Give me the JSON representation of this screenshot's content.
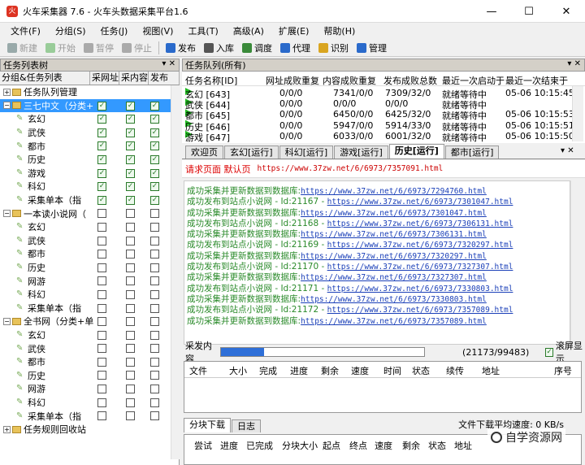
{
  "window": {
    "title": "火车采集器 7.6 - 火车头数据采集平台1.6",
    "icon_text": "火",
    "min": "—",
    "max": "☐",
    "close": "✕"
  },
  "menu": [
    "文件(F)",
    "分组(S)",
    "任务(J)",
    "视图(V)",
    "工具(T)",
    "高级(A)",
    "扩展(E)",
    "帮助(H)"
  ],
  "toolbar": [
    {
      "label": "新建",
      "enabled": false,
      "icon": "new-icon",
      "color": "#9aa"
    },
    {
      "label": "开始",
      "enabled": false,
      "icon": "play-icon",
      "color": "#9c9"
    },
    {
      "label": "暂停",
      "enabled": false,
      "icon": "pause-icon",
      "color": "#aaa"
    },
    {
      "label": "停止",
      "enabled": false,
      "icon": "stop-icon",
      "color": "#aaa"
    },
    {
      "label": "发布",
      "enabled": true,
      "icon": "publish-icon",
      "color": "#2a6acb"
    },
    {
      "label": "入库",
      "enabled": true,
      "icon": "import-icon",
      "color": "#555"
    },
    {
      "label": "调度",
      "enabled": true,
      "icon": "schedule-icon",
      "color": "#3a8a3a"
    },
    {
      "label": "代理",
      "enabled": true,
      "icon": "proxy-icon",
      "color": "#2a6acb"
    },
    {
      "label": "识别",
      "enabled": true,
      "icon": "recognize-icon",
      "color": "#d9a520"
    },
    {
      "label": "管理",
      "enabled": true,
      "icon": "manage-icon",
      "color": "#2a6acb"
    }
  ],
  "left": {
    "title": "任务列表树",
    "columns": [
      "分组&任务列表",
      "采网址",
      "采内容",
      "发布"
    ],
    "tree": [
      {
        "name": "任务队列管理",
        "level": 0,
        "kind": "root",
        "checks": null
      },
      {
        "name": "三七中文（分类+",
        "level": 0,
        "kind": "folder",
        "checks": [
          true,
          true,
          true
        ],
        "selected": true
      },
      {
        "name": "玄幻",
        "level": 1,
        "kind": "task",
        "checks": [
          true,
          true,
          true
        ]
      },
      {
        "name": "武侠",
        "level": 1,
        "kind": "task",
        "checks": [
          true,
          true,
          true
        ]
      },
      {
        "name": "都市",
        "level": 1,
        "kind": "task",
        "checks": [
          true,
          true,
          true
        ]
      },
      {
        "name": "历史",
        "level": 1,
        "kind": "task",
        "checks": [
          true,
          true,
          true
        ]
      },
      {
        "name": "游戏",
        "level": 1,
        "kind": "task",
        "checks": [
          true,
          true,
          true
        ]
      },
      {
        "name": "科幻",
        "level": 1,
        "kind": "task",
        "checks": [
          true,
          true,
          true
        ]
      },
      {
        "name": "采集单本（指",
        "level": 1,
        "kind": "task",
        "checks": [
          true,
          true,
          true
        ]
      },
      {
        "name": "一本读小说网（",
        "level": 0,
        "kind": "folder",
        "checks": [
          false,
          false,
          false
        ]
      },
      {
        "name": "玄幻",
        "level": 1,
        "kind": "task",
        "checks": [
          false,
          false,
          false
        ]
      },
      {
        "name": "武侠",
        "level": 1,
        "kind": "task",
        "checks": [
          false,
          false,
          false
        ]
      },
      {
        "name": "都市",
        "level": 1,
        "kind": "task",
        "checks": [
          false,
          false,
          false
        ]
      },
      {
        "name": "历史",
        "level": 1,
        "kind": "task",
        "checks": [
          false,
          false,
          false
        ]
      },
      {
        "name": "网游",
        "level": 1,
        "kind": "task",
        "checks": [
          false,
          false,
          false
        ]
      },
      {
        "name": "科幻",
        "level": 1,
        "kind": "task",
        "checks": [
          false,
          false,
          false
        ]
      },
      {
        "name": "采集单本（指",
        "level": 1,
        "kind": "task",
        "checks": [
          false,
          false,
          false
        ]
      },
      {
        "name": "全书网（分类+单",
        "level": 0,
        "kind": "folder",
        "checks": [
          false,
          false,
          false
        ]
      },
      {
        "name": "玄幻",
        "level": 1,
        "kind": "task",
        "checks": [
          false,
          false,
          false
        ]
      },
      {
        "name": "武侠",
        "level": 1,
        "kind": "task",
        "checks": [
          false,
          false,
          false
        ]
      },
      {
        "name": "都市",
        "level": 1,
        "kind": "task",
        "checks": [
          false,
          false,
          false
        ]
      },
      {
        "name": "历史",
        "level": 1,
        "kind": "task",
        "checks": [
          false,
          false,
          false
        ]
      },
      {
        "name": "网游",
        "level": 1,
        "kind": "task",
        "checks": [
          false,
          false,
          false
        ]
      },
      {
        "name": "科幻",
        "level": 1,
        "kind": "task",
        "checks": [
          false,
          false,
          false
        ]
      },
      {
        "name": "采集单本（指",
        "level": 1,
        "kind": "task",
        "checks": [
          false,
          false,
          false
        ]
      },
      {
        "name": "任务规则回收站",
        "level": 0,
        "kind": "root",
        "checks": null
      }
    ]
  },
  "queue": {
    "title": "任务队列(所有)",
    "columns": [
      "任务名称[ID]",
      "网址成败重复",
      "内容成败重复",
      "发布成败总数",
      "最近一次启动于",
      "最近一次结束于"
    ],
    "rows": [
      [
        "玄幻 [643]",
        "0/0/0",
        "7341/0/0",
        "7309/32/0",
        "就绪等待中",
        "05-06 10:15:45"
      ],
      [
        "武侠 [644]",
        "0/0/0",
        "0/0/0",
        "0/0/0",
        "就绪等待中",
        ""
      ],
      [
        "都市 [645]",
        "0/0/0",
        "6450/0/0",
        "6425/32/0",
        "就绪等待中",
        "05-06 10:15:53"
      ],
      [
        "历史 [646]",
        "0/0/0",
        "5947/0/0",
        "5914/33/0",
        "就绪等待中",
        "05-06 10:15:51"
      ],
      [
        "游戏 [647]",
        "0/0/0",
        "6033/0/0",
        "6001/32/0",
        "就绪等待中",
        "05-06 10:15:50"
      ]
    ]
  },
  "tabs": [
    "欢迎页",
    "玄幻[运行]",
    "科幻[运行]",
    "游戏[运行]",
    "历史[运行]",
    "都市[运行]"
  ],
  "active_tab": 4,
  "request": {
    "label": "请求页面 默认页",
    "url": "https://www.37zw.net/6/6973/7357091.html"
  },
  "log": [
    {
      "text": "成功采集并更新数据到数据库:",
      "url": "https://www.37zw.net/6/6973/7294760.html"
    },
    {
      "text": "成功发布到站点小说网 - Id:21167 - ",
      "url": "https://www.37zw.net/6/6973/7301047.html"
    },
    {
      "text": "成功采集并更新数据到数据库:",
      "url": "https://www.37zw.net/6/6973/7301047.html"
    },
    {
      "text": "成功发布到站点小说网 - Id:21168 - ",
      "url": "https://www.37zw.net/6/6973/7306131.html"
    },
    {
      "text": "成功采集并更新数据到数据库:",
      "url": "https://www.37zw.net/6/6973/7306131.html"
    },
    {
      "text": "成功发布到站点小说网 - Id:21169 - ",
      "url": "https://www.37zw.net/6/6973/7320297.html"
    },
    {
      "text": "成功采集并更新数据到数据库:",
      "url": "https://www.37zw.net/6/6973/7320297.html"
    },
    {
      "text": "成功发布到站点小说网 - Id:21170 - ",
      "url": "https://www.37zw.net/6/6973/7327307.html"
    },
    {
      "text": "成功采集并更新数据到数据库:",
      "url": "https://www.37zw.net/6/6973/7327307.html"
    },
    {
      "text": "成功发布到站点小说网 - Id:21171 - ",
      "url": "https://www.37zw.net/6/6973/7330803.html"
    },
    {
      "text": "成功采集并更新数据到数据库:",
      "url": "https://www.37zw.net/6/6973/7330803.html"
    },
    {
      "text": "成功发布到站点小说网 - Id:21172 - ",
      "url": "https://www.37zw.net/6/6973/7357089.html"
    },
    {
      "text": "成功采集并更新数据到数据库:",
      "url": "https://www.37zw.net/6/6973/7357089.html"
    }
  ],
  "progress": {
    "label": "采发内容",
    "value_text": "(21173/99483)",
    "fraction": 0.213,
    "checkbox_label": "滚屏显示"
  },
  "download_columns": [
    "文件",
    "大小",
    "完成",
    "进度",
    "剩余",
    "速度",
    "时间",
    "状态",
    "续传",
    "地址",
    "序号"
  ],
  "bottom_tabs": [
    "分块下载",
    "日志"
  ],
  "speed_text": "文件下载平均速度:  0 KB/s",
  "block_columns": [
    "尝试",
    "进度",
    "已完成",
    "分块大小",
    "起点",
    "终点",
    "速度",
    "剩余",
    "状态",
    "地址"
  ],
  "watermark": "自学资源网"
}
